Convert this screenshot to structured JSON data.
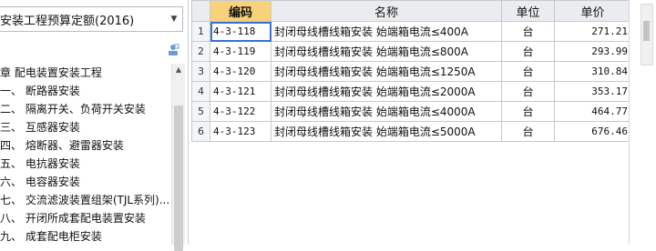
{
  "quota_selector": {
    "value": "安装工程预算定额(2016)"
  },
  "tree": {
    "items": [
      {
        "label": "章 配电装置安装工程",
        "kind": "chapter"
      },
      {
        "label": "一、 断路器安装",
        "kind": "section"
      },
      {
        "label": "二、 隔离开关、负荷开关安装",
        "kind": "section"
      },
      {
        "label": "三、 互感器安装",
        "kind": "section"
      },
      {
        "label": "四、 熔断器、避雷器安装",
        "kind": "section"
      },
      {
        "label": "五、 电抗器安装",
        "kind": "section"
      },
      {
        "label": "六、 电容器安装",
        "kind": "section"
      },
      {
        "label": "七、 交流滤波装置组架(TJL系列)...",
        "kind": "section"
      },
      {
        "label": "八、 开闭所成套配电装置安装",
        "kind": "section"
      },
      {
        "label": "九、 成套配电柜安装",
        "kind": "section"
      }
    ]
  },
  "table": {
    "headers": {
      "rownum": "",
      "code": "编码",
      "name": "名称",
      "unit": "单位",
      "price": "单价"
    },
    "rows": [
      {
        "num": "1",
        "code": "4-3-118",
        "name": "封闭母线槽线箱安装 始端箱电流≤400A",
        "unit": "台",
        "price": "271.21"
      },
      {
        "num": "2",
        "code": "4-3-119",
        "name": "封闭母线槽线箱安装 始端箱电流≤800A",
        "unit": "台",
        "price": "293.99"
      },
      {
        "num": "3",
        "code": "4-3-120",
        "name": "封闭母线槽线箱安装 始端箱电流≤1250A",
        "unit": "台",
        "price": "310.84"
      },
      {
        "num": "4",
        "code": "4-3-121",
        "name": "封闭母线槽线箱安装 始端箱电流≤2000A",
        "unit": "台",
        "price": "353.17"
      },
      {
        "num": "5",
        "code": "4-3-122",
        "name": "封闭母线槽线箱安装 始端箱电流≤4000A",
        "unit": "台",
        "price": "464.77"
      },
      {
        "num": "6",
        "code": "4-3-123",
        "name": "封闭母线槽线箱安装 始端箱电流≤5000A",
        "unit": "台",
        "price": "676.46"
      }
    ]
  },
  "colors": {
    "sorted_header": "#f7d27a",
    "selection": "#3a6fd8",
    "grid_line": "#c6c9ce"
  },
  "icons": {
    "dropdown": "chevron-down-icon",
    "toolbar": "user-icon"
  }
}
